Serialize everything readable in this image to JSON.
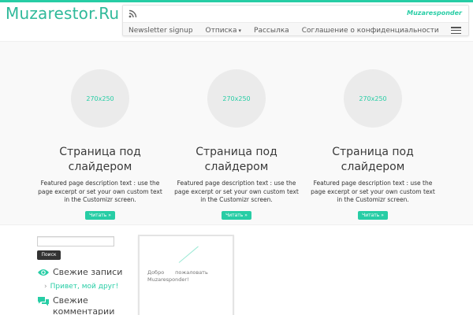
{
  "site": {
    "logo": "Muzarestor.Ru",
    "tagline": "Muzaresponder"
  },
  "menu": {
    "items": [
      "Newsletter signup",
      "Отписка",
      "Рассылка",
      "Соглашение о конфиденциальности"
    ],
    "dropdown_caret": "▾"
  },
  "featured": [
    {
      "thumb": "270x250",
      "title": "Страница под слайдером",
      "desc": "Featured page description text : use the page excerpt or set your own custom text in the Customizr screen.",
      "button": "Читать »"
    },
    {
      "thumb": "270x250",
      "title": "Страница под слайдером",
      "desc": "Featured page description text : use the page excerpt or set your own custom text in the Customizr screen.",
      "button": "Читать »"
    },
    {
      "thumb": "270x250",
      "title": "Страница под слайдером",
      "desc": "Featured page description text : use the page excerpt or set your own custom text in the Customizr screen.",
      "button": "Читать »"
    }
  ],
  "sidebar": {
    "search_button": "Поиск",
    "recent_posts_title": "Свежие записи",
    "recent_post_link": "Привет, мой друг!",
    "link_arrow": "›",
    "recent_comments_title": "Свежие комментарии"
  },
  "post": {
    "line1_a": "Добро",
    "line1_b": "пожаловать",
    "line2": "Muzaresponder!"
  },
  "colors": {
    "accent": "#27cda5"
  },
  "icons": [
    "rss-icon",
    "menu-icon",
    "eye-icon",
    "comments-icon"
  ]
}
